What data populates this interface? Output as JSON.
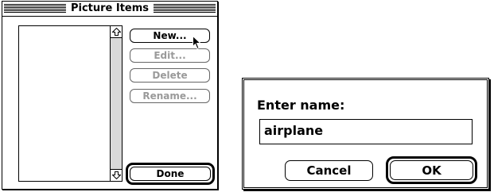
{
  "picture_items_window": {
    "title": "Picture Items",
    "buttons": {
      "new_label": "New...",
      "edit_label": "Edit...",
      "delete_label": "Delete",
      "rename_label": "Rename...",
      "done_label": "Done"
    },
    "icons": {
      "scroll_up": "scroll-up-arrow-icon",
      "scroll_down": "scroll-down-arrow-icon",
      "pointer": "mouse-pointer-icon"
    }
  },
  "enter_name_dialog": {
    "prompt": "Enter name:",
    "name_field_value": "airplane",
    "cancel_label": "Cancel",
    "ok_label": "OK"
  },
  "colors": {
    "ink": "#000000",
    "background": "#ffffff",
    "disabled_text": "#9a9a9a",
    "scroll_track": "#d9d9d9"
  }
}
